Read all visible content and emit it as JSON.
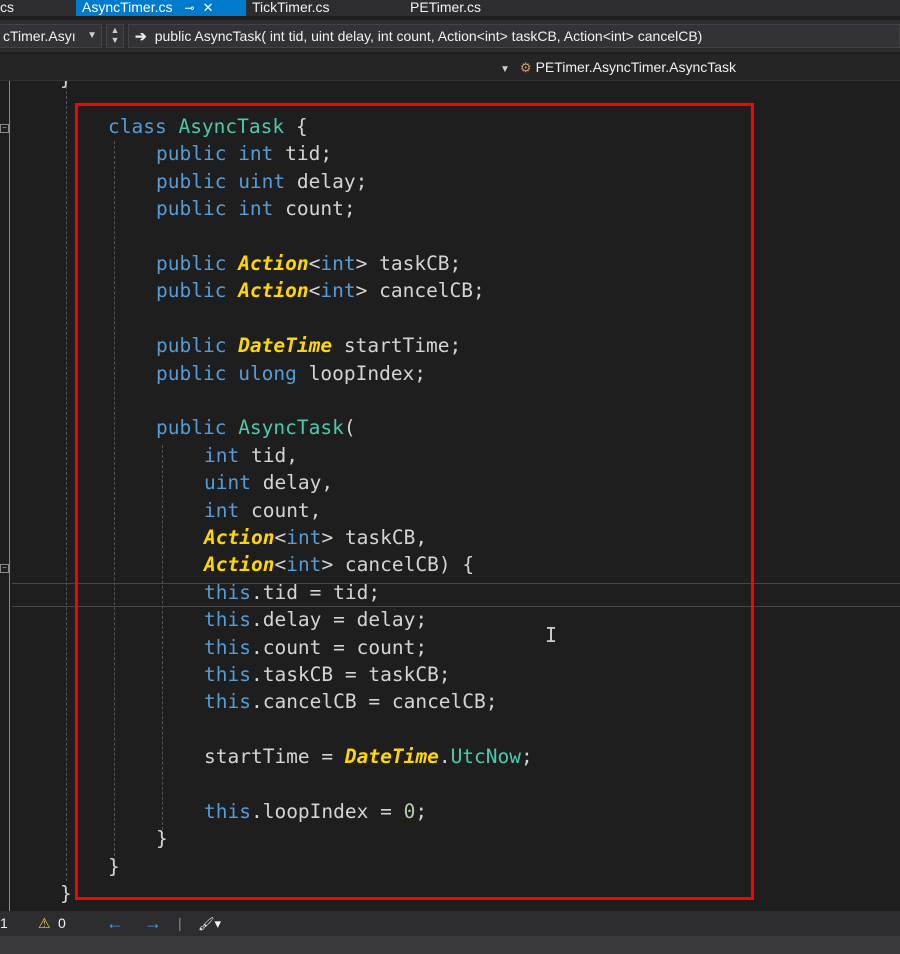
{
  "tabs": [
    {
      "label": "cs",
      "active": false
    },
    {
      "label": "AsyncTimer.cs",
      "active": true,
      "pin_icon": "⊸",
      "close_icon": "✕"
    },
    {
      "label": "TickTimer.cs",
      "active": false
    },
    {
      "label": "PETimer.cs",
      "active": false
    }
  ],
  "navbar": {
    "project_combo": "cTimer.Asyı",
    "member_combo": "public AsyncTask( int tid, uint delay, int count, Action<int> taskCB, Action<int> cancelCB)",
    "scope_combo": "PETimer.AsyncTimer.AsyncTask"
  },
  "code": {
    "top_partial": "}",
    "lines": [
      {
        "indent": 0,
        "tokens": [
          [
            "kw",
            "class "
          ],
          [
            "nm",
            "AsyncTask"
          ],
          [
            "pl",
            " {"
          ]
        ]
      },
      {
        "indent": 1,
        "tokens": [
          [
            "kw",
            "public "
          ],
          [
            "kw",
            "int "
          ],
          [
            "pl",
            "tid;"
          ]
        ]
      },
      {
        "indent": 1,
        "tokens": [
          [
            "kw",
            "public "
          ],
          [
            "kw",
            "uint "
          ],
          [
            "pl",
            "delay;"
          ]
        ]
      },
      {
        "indent": 1,
        "tokens": [
          [
            "kw",
            "public "
          ],
          [
            "kw",
            "int "
          ],
          [
            "pl",
            "count;"
          ]
        ]
      },
      {
        "indent": 0,
        "tokens": []
      },
      {
        "indent": 1,
        "tokens": [
          [
            "kw",
            "public "
          ],
          [
            "ty",
            "Action"
          ],
          [
            "pl",
            "<"
          ],
          [
            "kw",
            "int"
          ],
          [
            "pl",
            "> taskCB;"
          ]
        ]
      },
      {
        "indent": 1,
        "tokens": [
          [
            "kw",
            "public "
          ],
          [
            "ty",
            "Action"
          ],
          [
            "pl",
            "<"
          ],
          [
            "kw",
            "int"
          ],
          [
            "pl",
            "> cancelCB;"
          ]
        ]
      },
      {
        "indent": 0,
        "tokens": []
      },
      {
        "indent": 1,
        "tokens": [
          [
            "kw",
            "public "
          ],
          [
            "ty",
            "DateTime"
          ],
          [
            "pl",
            " startTime;"
          ]
        ]
      },
      {
        "indent": 1,
        "tokens": [
          [
            "kw",
            "public "
          ],
          [
            "kw",
            "ulong "
          ],
          [
            "pl",
            "loopIndex;"
          ]
        ]
      },
      {
        "indent": 0,
        "tokens": []
      },
      {
        "indent": 1,
        "tokens": [
          [
            "kw",
            "public "
          ],
          [
            "nm",
            "AsyncTask"
          ],
          [
            "pl",
            "("
          ]
        ]
      },
      {
        "indent": 2,
        "tokens": [
          [
            "kw",
            "int "
          ],
          [
            "pl",
            "tid,"
          ]
        ]
      },
      {
        "indent": 2,
        "tokens": [
          [
            "kw",
            "uint "
          ],
          [
            "pl",
            "delay,"
          ]
        ]
      },
      {
        "indent": 2,
        "tokens": [
          [
            "kw",
            "int "
          ],
          [
            "pl",
            "count,"
          ]
        ]
      },
      {
        "indent": 2,
        "tokens": [
          [
            "ty",
            "Action"
          ],
          [
            "pl",
            "<"
          ],
          [
            "kw",
            "int"
          ],
          [
            "pl",
            "> taskCB,"
          ]
        ]
      },
      {
        "indent": 2,
        "tokens": [
          [
            "ty",
            "Action"
          ],
          [
            "pl",
            "<"
          ],
          [
            "kw",
            "int"
          ],
          [
            "pl",
            "> cancelCB) {"
          ]
        ]
      },
      {
        "indent": 2,
        "tokens": [
          [
            "kw",
            "this"
          ],
          [
            "pl",
            ".tid = tid;"
          ]
        ]
      },
      {
        "indent": 2,
        "tokens": [
          [
            "kw",
            "this"
          ],
          [
            "pl",
            ".delay = delay;"
          ]
        ]
      },
      {
        "indent": 2,
        "tokens": [
          [
            "kw",
            "this"
          ],
          [
            "pl",
            ".count = count;"
          ]
        ]
      },
      {
        "indent": 2,
        "tokens": [
          [
            "kw",
            "this"
          ],
          [
            "pl",
            ".taskCB = taskCB;"
          ]
        ]
      },
      {
        "indent": 2,
        "tokens": [
          [
            "kw",
            "this"
          ],
          [
            "pl",
            ".cancelCB = cancelCB;"
          ]
        ]
      },
      {
        "indent": 0,
        "tokens": []
      },
      {
        "indent": 2,
        "tokens": [
          [
            "pl",
            "startTime = "
          ],
          [
            "ty",
            "DateTime"
          ],
          [
            "pl",
            "."
          ],
          [
            "nm",
            "UtcNow"
          ],
          [
            "pl",
            ";"
          ]
        ]
      },
      {
        "indent": 0,
        "tokens": []
      },
      {
        "indent": 2,
        "tokens": [
          [
            "kw",
            "this"
          ],
          [
            "pl",
            ".loopIndex = "
          ],
          [
            "num",
            "0"
          ],
          [
            "pl",
            ";"
          ]
        ]
      },
      {
        "indent": 1,
        "tokens": [
          [
            "pl",
            "}"
          ]
        ]
      },
      {
        "indent": 0,
        "tokens": [
          [
            "pl",
            "}"
          ]
        ]
      },
      {
        "indent": -1,
        "tokens": [
          [
            "pl",
            "}"
          ]
        ]
      }
    ]
  },
  "statusbar": {
    "line_indicator": "1",
    "warnings_icon": "⚠",
    "warnings_count": "0",
    "back_icon": "←",
    "forward_icon": "→",
    "brush_icon": "🖌▾"
  },
  "colors": {
    "keyword": "#569cd6",
    "type": "#ffd700",
    "name": "#4ec9b0",
    "plain": "#d4d4d4",
    "highlight_box": "#ff0000",
    "active_tab": "#007acc"
  }
}
